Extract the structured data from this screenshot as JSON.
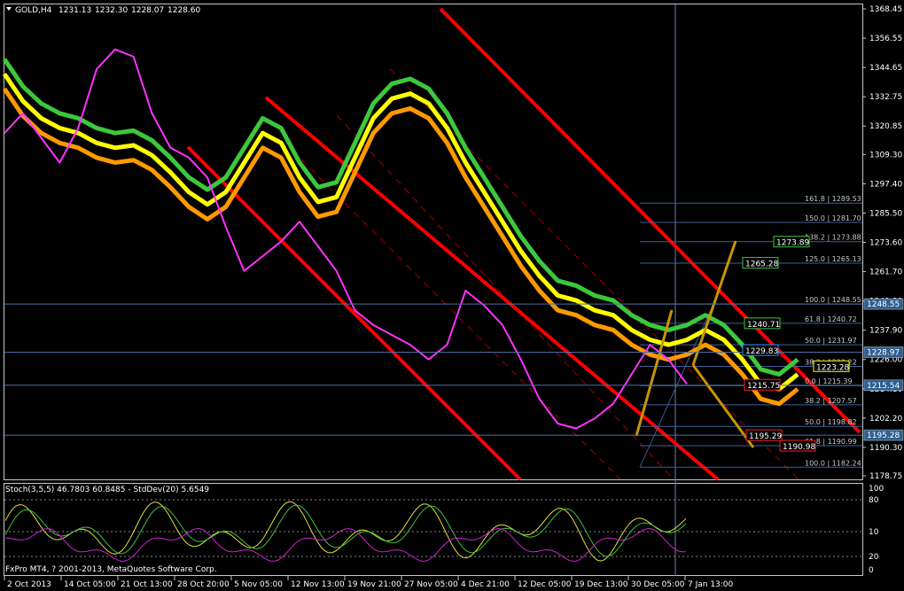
{
  "header": {
    "symbol": "GOLD,H4",
    "open": "1231.13",
    "high": "1232.30",
    "low": "1228.07",
    "close": "1228.60"
  },
  "footer": {
    "copyright": "FxPro MT4, ? 2001-2013, MetaQuotes Software Corp."
  },
  "chart_data": {
    "type": "line",
    "title": "",
    "price_axis": {
      "ticks": [
        "1368.45",
        "1356.55",
        "1344.65",
        "1332.75",
        "1320.85",
        "1309.30",
        "1297.40",
        "1285.50",
        "1273.60",
        "1261.70",
        "1249.80",
        "1237.90",
        "1226.00",
        "1214.10",
        "1202.20",
        "1190.30",
        "1178.75"
      ],
      "ylim": [
        1178.75,
        1368.45
      ],
      "price_labels": [
        {
          "value": 1248.55,
          "label": "1248.55",
          "color": "#2f5f8f"
        },
        {
          "value": 1228.97,
          "label": "1228.97",
          "color": "#2f5f8f"
        },
        {
          "value": 1215.54,
          "label": "1215.54",
          "color": "#2f5f8f"
        },
        {
          "value": 1195.28,
          "label": "1195.28",
          "color": "#2f5f8f"
        }
      ]
    },
    "time_axis": {
      "labels": [
        "2 Oct 2013",
        "14 Oct 05:00",
        "21 Oct 13:00",
        "28 Oct 20:00",
        "5 Nov 05:00",
        "12 Nov 13:00",
        "19 Nov 21:00",
        "27 Nov 05:00",
        "4 Dec 21:00",
        "12 Dec 05:00",
        "19 Dec 13:00",
        "30 Dec 05:00",
        "7 Jan 13:00"
      ]
    },
    "fibonacci": {
      "levels": [
        {
          "label": "161.8 | 1289.53",
          "value": 1289.53
        },
        {
          "label": "150.0 | 1281.70",
          "value": 1281.7
        },
        {
          "label": "138.2 | 1273.88",
          "value": 1273.88
        },
        {
          "label": "125.0 | 1265.13",
          "value": 1265.13
        },
        {
          "label": "100.0 | 1248.55",
          "value": 1248.55
        },
        {
          "label": "61.8 | 1240.72",
          "value": 1240.72
        },
        {
          "label": "50.0 | 1231.97",
          "value": 1231.97
        },
        {
          "label": "38.2 | 1223.22",
          "value": 1223.22
        },
        {
          "label": "0.0 | 1215.39",
          "value": 1215.39
        },
        {
          "label": "38.2 | 1207.57",
          "value": 1207.57
        },
        {
          "label": "50.0 | 1198.82",
          "value": 1198.82
        },
        {
          "label": "61.8 | 1190.99",
          "value": 1190.99
        },
        {
          "label": "100.0 | 1182.24",
          "value": 1182.24
        }
      ]
    },
    "boxed_labels": [
      {
        "text": "1273.89",
        "value": 1273.89,
        "color": "#3cc83c"
      },
      {
        "text": "1265.28",
        "value": 1265.28,
        "color": "#3cc83c"
      },
      {
        "text": "1240.71",
        "value": 1240.71,
        "color": "#3cc83c"
      },
      {
        "text": "1229.83",
        "value": 1229.83,
        "color": "#2f8fff"
      },
      {
        "text": "1223.28",
        "value": 1223.28,
        "color": "#ffff00"
      },
      {
        "text": "1215.75",
        "value": 1215.75,
        "color": "#ff2020"
      },
      {
        "text": "1195.29",
        "value": 1195.29,
        "color": "#ff2020"
      },
      {
        "text": "1190.98",
        "value": 1190.98,
        "color": "#ff2020"
      }
    ],
    "series": [
      {
        "color": "#3cc83c",
        "values": [
          1348,
          1337,
          1330,
          1326,
          1324,
          1320,
          1318,
          1319,
          1315,
          1308,
          1300,
          1295,
          1300,
          1312,
          1324,
          1320,
          1306,
          1296,
          1298,
          1314,
          1330,
          1338,
          1340,
          1336,
          1326,
          1312,
          1300,
          1288,
          1276,
          1266,
          1258,
          1256,
          1252,
          1250,
          1244,
          1240,
          1238,
          1240,
          1244,
          1240,
          1232,
          1222,
          1220,
          1226
        ]
      },
      {
        "color": "#ffff00",
        "values": [
          1342,
          1331,
          1324,
          1320,
          1318,
          1314,
          1312,
          1313,
          1309,
          1302,
          1294,
          1289,
          1294,
          1306,
          1318,
          1314,
          1300,
          1290,
          1292,
          1308,
          1324,
          1332,
          1334,
          1330,
          1320,
          1306,
          1294,
          1282,
          1270,
          1260,
          1252,
          1250,
          1246,
          1244,
          1238,
          1234,
          1232,
          1234,
          1238,
          1234,
          1226,
          1216,
          1214,
          1220
        ]
      },
      {
        "color": "#ff9900",
        "values": [
          1336,
          1325,
          1318,
          1314,
          1312,
          1308,
          1306,
          1307,
          1303,
          1296,
          1288,
          1283,
          1288,
          1300,
          1312,
          1308,
          1294,
          1284,
          1286,
          1302,
          1318,
          1326,
          1328,
          1324,
          1314,
          1300,
          1288,
          1276,
          1264,
          1254,
          1246,
          1244,
          1240,
          1238,
          1232,
          1228,
          1226,
          1228,
          1232,
          1228,
          1220,
          1210,
          1208,
          1214
        ]
      },
      {
        "color": "#ff33ff",
        "values": [
          1318,
          1326,
          1316,
          1306,
          1320,
          1344,
          1352,
          1349,
          1326,
          1312,
          1308,
          1300,
          1280,
          1262,
          1268,
          1274,
          1282,
          1272,
          1262,
          1246,
          1240,
          1236,
          1232,
          1226,
          1232,
          1254,
          1248,
          1240,
          1226,
          1210,
          1200,
          1198,
          1202,
          1208,
          1220,
          1232,
          1226,
          1216
        ]
      }
    ],
    "stochastic": {
      "header": "Stoch(3,5,5) 46.7803 60.8485 - StdDev(20) 5.6549",
      "levels": [
        "100",
        "80",
        "10",
        "20",
        "0"
      ]
    }
  }
}
